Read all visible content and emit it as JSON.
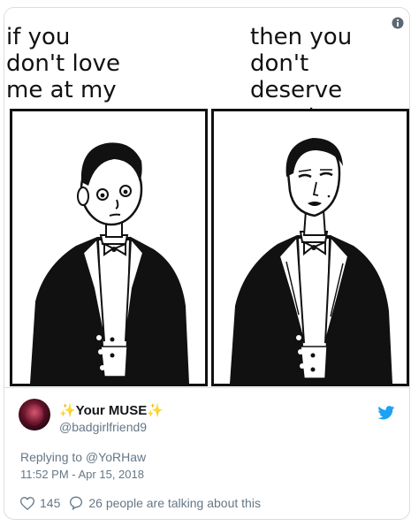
{
  "meme": {
    "left_caption": "if you\ndon't love\nme at my",
    "right_caption": "then you don't\ndeserve\nme at my"
  },
  "tweet": {
    "display_name": "✨Your MUSE✨",
    "handle": "@badgirlfriend9",
    "replying_to": "Replying to @YoRHaw",
    "timestamp": "11:52 PM - Apr 15, 2018",
    "likes": "145",
    "conversation": "26 people are talking about this"
  },
  "icons": {
    "info": "info-icon",
    "bird": "twitter-bird-icon",
    "like": "heart-icon",
    "reply": "speech-bubble-icon"
  },
  "colors": {
    "brand": "#1da1f2",
    "secondary_text": "#657786"
  }
}
